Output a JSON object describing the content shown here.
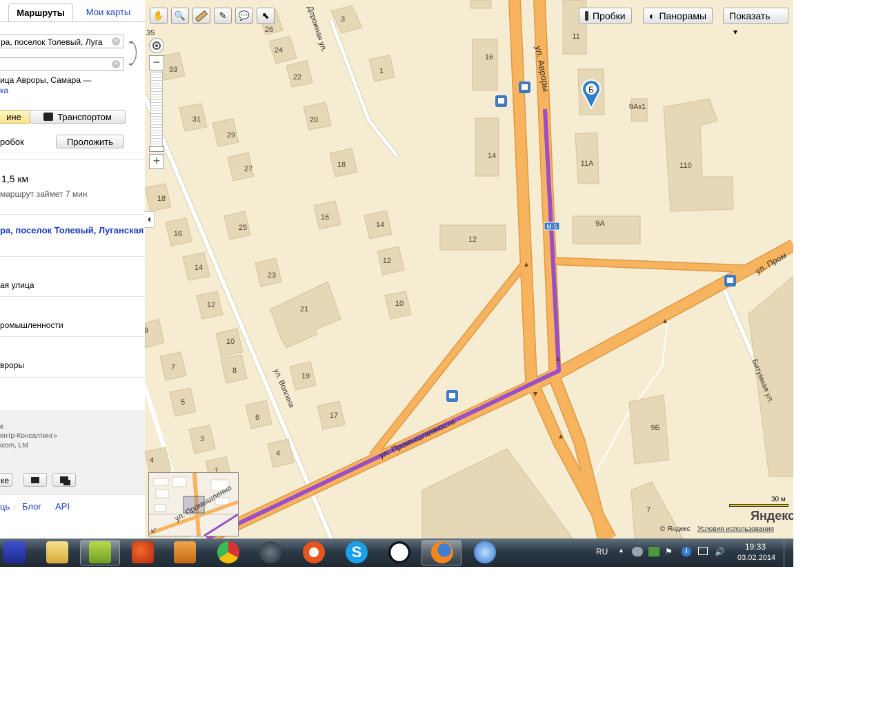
{
  "tabs": {
    "routes": "Маршруты",
    "my_maps": "Мои карты"
  },
  "route_form": {
    "from_value": "ра, поселок Толевый, Луга",
    "to_value": "",
    "suggestion_line1": "ица Авроры, Самара —",
    "suggestion_line2": "ка",
    "mode_car": "ине",
    "mode_transport": "Транспортом",
    "traffic_label": "робок",
    "build_button": "Проложить",
    "distance": "1,5 км",
    "duration": "маршрут займет 7 мин"
  },
  "route_steps": {
    "start": "ра, поселок Толевый, Луганская",
    "step1": "ая улица",
    "step2": "ромышленности",
    "step3": "вроры"
  },
  "footer": {
    "credit1": "ентр-Консалтинг»",
    "credit2": "icom, Ltd",
    "share_label": "ке",
    "links": [
      "ць",
      "Блог",
      "API"
    ]
  },
  "map": {
    "buttons": {
      "traffic": "Пробки",
      "panoramas": "Панорамы",
      "show": "Показать"
    },
    "zoom_level_label": "35",
    "marker_label": "Б",
    "streets": {
      "avrora": "ул. Авроры",
      "promyshlennosti": "ул. Промышленности",
      "promyshl_short": "ул. Пром",
      "dorozhnaya": "Дорожная ул.",
      "volgina": "ул. Волгина",
      "bitumnaya": "Битумная ул.",
      "minimap_street": "ул. Промышленно"
    },
    "road_badge": "M-5",
    "house_numbers": {
      "h3": "3",
      "h26": "26",
      "h24": "24",
      "h33": "33",
      "h1": "1",
      "h22": "22",
      "h31": "31",
      "h29": "29",
      "h20": "20",
      "h18a": "18",
      "h27": "27",
      "h18b": "18",
      "h16a": "16",
      "h25": "25",
      "h16b": "16",
      "h14a": "14",
      "h14b": "14",
      "h23": "23",
      "h12a": "12",
      "h12b": "12",
      "h21": "21",
      "h10a": "10",
      "h10b": "10",
      "h9": "9",
      "h8": "8",
      "h7": "7",
      "h19": "19",
      "h5": "5",
      "h6": "6",
      "h17": "17",
      "h3b": "3",
      "h4": "4",
      "h4b": "4",
      "h1b": "1",
      "h16c": "16",
      "h14c": "14",
      "h12c": "12",
      "h11": "11",
      "h9ak1": "9Ак1",
      "h11a": "11А",
      "h110": "110",
      "h9a": "9А",
      "h9b": "9Б",
      "h7b": "7"
    },
    "scale_label": "30 м",
    "logo": "Яндекс",
    "copyright": "© Яндекс",
    "terms": "Условия использования"
  },
  "taskbar": {
    "lang": "RU",
    "time": "19:33",
    "date": "03.02.2014"
  },
  "colors": {
    "map_bg": "#f5ecd2",
    "road_orange": "#f7b35e",
    "route_purple": "#9a4fc7",
    "building": "#e6d7b6",
    "link_blue": "#1a3dc1"
  }
}
